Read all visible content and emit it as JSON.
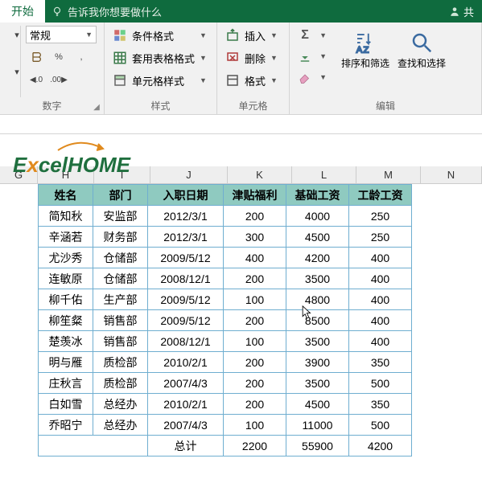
{
  "titlebar": {
    "start_tab": "开始",
    "tell_me": "告诉我你想要做什么",
    "share": "共"
  },
  "ribbon": {
    "number": {
      "label": "数字",
      "format_combo": "常规"
    },
    "styles": {
      "label": "样式",
      "conditional": "条件格式",
      "table": "套用表格格式",
      "cell": "单元格样式"
    },
    "cells": {
      "label": "单元格",
      "insert": "插入",
      "delete": "删除",
      "format": "格式"
    },
    "editing": {
      "label": "编辑",
      "sort_filter": "排序和筛选",
      "find_select": "查找和选择"
    }
  },
  "columns": [
    "G",
    "H",
    "I",
    "J",
    "K",
    "L",
    "M",
    "N"
  ],
  "table": {
    "headers": [
      "姓名",
      "部门",
      "入职日期",
      "津贴福利",
      "基础工资",
      "工龄工资"
    ],
    "rows": [
      [
        "简知秋",
        "安监部",
        "2012/3/1",
        "200",
        "4000",
        "250"
      ],
      [
        "辛涵若",
        "财务部",
        "2012/3/1",
        "300",
        "4500",
        "250"
      ],
      [
        "尤沙秀",
        "仓储部",
        "2009/5/12",
        "400",
        "4200",
        "400"
      ],
      [
        "连敏原",
        "仓储部",
        "2008/12/1",
        "200",
        "3500",
        "400"
      ],
      [
        "柳千佑",
        "生产部",
        "2009/5/12",
        "100",
        "4800",
        "400"
      ],
      [
        "柳笙粲",
        "销售部",
        "2009/5/12",
        "200",
        "8500",
        "400"
      ],
      [
        "楚羡冰",
        "销售部",
        "2008/12/1",
        "100",
        "3500",
        "400"
      ],
      [
        "明与雁",
        "质检部",
        "2010/2/1",
        "200",
        "3900",
        "350"
      ],
      [
        "庄秋言",
        "质检部",
        "2007/4/3",
        "200",
        "3500",
        "500"
      ],
      [
        "白如雪",
        "总经办",
        "2010/2/1",
        "200",
        "4500",
        "350"
      ],
      [
        "乔昭宁",
        "总经办",
        "2007/4/3",
        "100",
        "11000",
        "500"
      ]
    ],
    "total_label": "总计",
    "totals": [
      "2200",
      "55900",
      "4200"
    ]
  },
  "watermark": {
    "text": "ExcelHOME"
  }
}
